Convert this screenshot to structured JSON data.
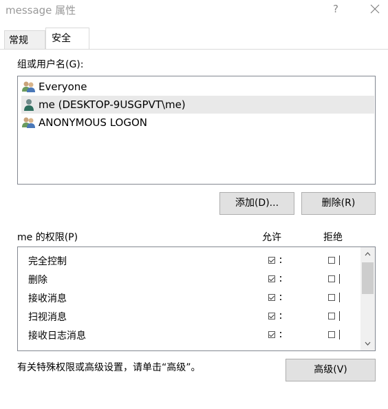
{
  "window": {
    "title": "message 属性",
    "help": "?"
  },
  "tabs": [
    {
      "label": "常规"
    },
    {
      "label": "安全"
    }
  ],
  "groups": {
    "label": "组或用户名(G):",
    "users": [
      {
        "name": "Everyone",
        "icon": "group-icon"
      },
      {
        "name": "me (DESKTOP-9USGPVT\\me)",
        "icon": "user-icon"
      },
      {
        "name": "ANONYMOUS LOGON",
        "icon": "group-icon"
      }
    ],
    "add_button": "添加(D)...",
    "remove_button": "删除(R)"
  },
  "permissions": {
    "header": "me 的权限(P)",
    "allow_header": "允许",
    "deny_header": "拒绝",
    "rows": [
      {
        "name": "完全控制",
        "allow": true,
        "deny": false
      },
      {
        "name": "删除",
        "allow": true,
        "deny": false
      },
      {
        "name": "接收消息",
        "allow": true,
        "deny": false
      },
      {
        "name": "扫视消息",
        "allow": true,
        "deny": false
      },
      {
        "name": "接收日志消息",
        "allow": true,
        "deny": false
      }
    ]
  },
  "advanced": {
    "hint": "有关特殊权限或高级设置，请单击“高级”。",
    "button": "高级(V)"
  },
  "colors": {
    "selected_row": "#e9e9e9",
    "button_bg": "#e1e1e1",
    "border": "#828790"
  }
}
